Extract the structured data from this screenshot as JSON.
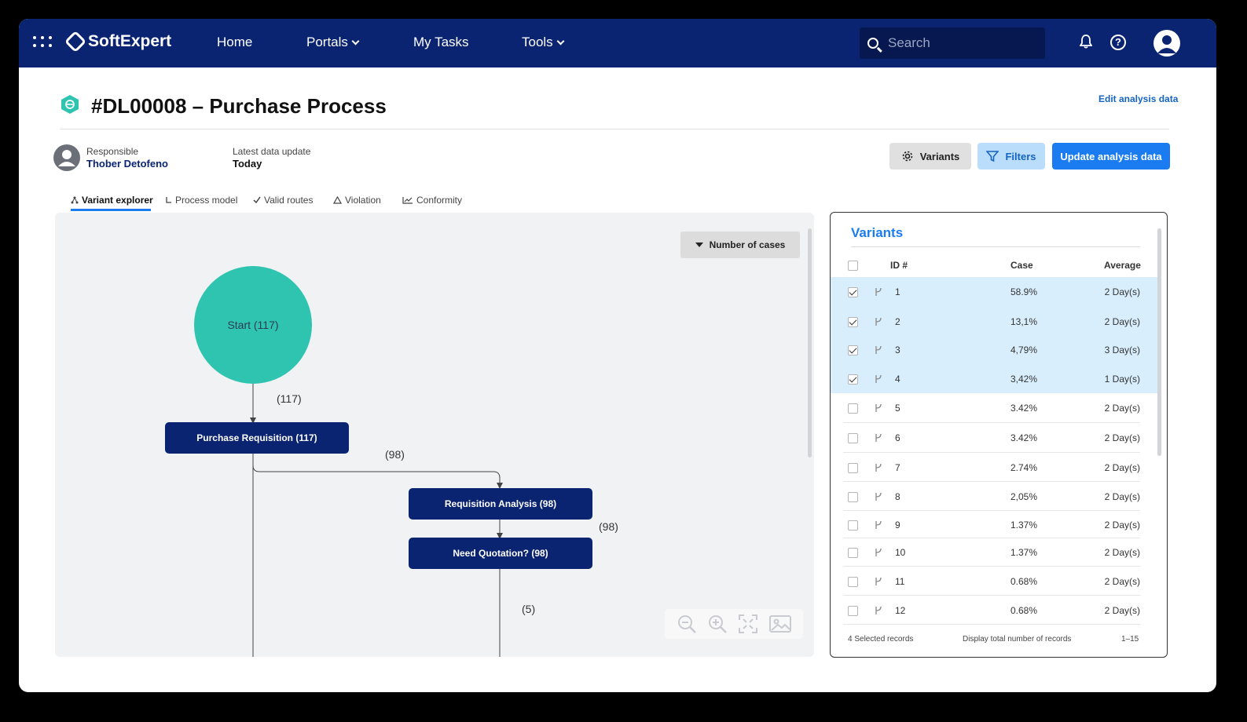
{
  "nav": {
    "brand": "SoftExpert",
    "items": [
      {
        "label": "Home",
        "has_menu": false
      },
      {
        "label": "Portals",
        "has_menu": true
      },
      {
        "label": "My Tasks",
        "has_menu": false
      },
      {
        "label": "Tools",
        "has_menu": true
      }
    ],
    "search_placeholder": "Search"
  },
  "header": {
    "title": "#DL00008 – Purchase Process",
    "edit_link": "Edit analysis data",
    "responsible_label": "Responsible",
    "responsible_name": "Thober Detofeno",
    "update_label": "Latest data update",
    "update_value": "Today",
    "buttons": {
      "variants": "Variants",
      "filters": "Filters",
      "update": "Update analysis data"
    }
  },
  "tabs": [
    {
      "label": "Variant explorer",
      "active": true,
      "icon": "variant-explorer-icon"
    },
    {
      "label": "Process model",
      "active": false,
      "icon": "process-model-icon"
    },
    {
      "label": "Valid routes",
      "active": false,
      "icon": "check-icon"
    },
    {
      "label": "Violation",
      "active": false,
      "icon": "warning-icon"
    },
    {
      "label": "Conformity",
      "active": false,
      "icon": "line-chart-icon"
    }
  ],
  "canvas": {
    "metric_selector": "Number of cases",
    "start_node": "Start (117)",
    "nodes": {
      "purchase_requisition": "Purchase Requisition (117)",
      "requisition_analysis": "Requisition Analysis (98)",
      "need_quotation": "Need Quotation? (98)"
    },
    "edge_labels": {
      "start_to_pr": "(117)",
      "pr_to_ra": "(98)",
      "ra_to_nq": "(98)",
      "nq_out": "(5)"
    }
  },
  "variants_panel": {
    "title": "Variants",
    "columns": {
      "id": "ID #",
      "case": "Case",
      "average": "Average"
    },
    "rows": [
      {
        "id": "1",
        "case": "58.9%",
        "average": "2 Day(s)",
        "selected": true
      },
      {
        "id": "2",
        "case": "13,1%",
        "average": "2 Day(s)",
        "selected": true
      },
      {
        "id": "3",
        "case": "4,79%",
        "average": "3 Day(s)",
        "selected": true
      },
      {
        "id": "4",
        "case": "3,42%",
        "average": "1 Day(s)",
        "selected": true
      },
      {
        "id": "5",
        "case": "3.42%",
        "average": "2 Day(s)",
        "selected": false
      },
      {
        "id": "6",
        "case": "3.42%",
        "average": "2 Day(s)",
        "selected": false
      },
      {
        "id": "7",
        "case": "2.74%",
        "average": "2 Day(s)",
        "selected": false
      },
      {
        "id": "8",
        "case": "2,05%",
        "average": "2 Day(s)",
        "selected": false
      },
      {
        "id": "9",
        "case": "1.37%",
        "average": "2 Day(s)",
        "selected": false
      },
      {
        "id": "10",
        "case": "1.37%",
        "average": "2 Day(s)",
        "selected": false
      },
      {
        "id": "11",
        "case": "0.68%",
        "average": "2 Day(s)",
        "selected": false
      },
      {
        "id": "12",
        "case": "0.68%",
        "average": "2 Day(s)",
        "selected": false
      }
    ],
    "footer": {
      "selected": "4 Selected records",
      "display_total": "Display total number of records",
      "range": "1–15"
    }
  },
  "colors": {
    "nav_bg": "#0a2472",
    "accent": "#1a7cf0",
    "start_node": "#2ec4b0",
    "node_bg": "#0a2472",
    "selected_row": "#d9eefc"
  }
}
